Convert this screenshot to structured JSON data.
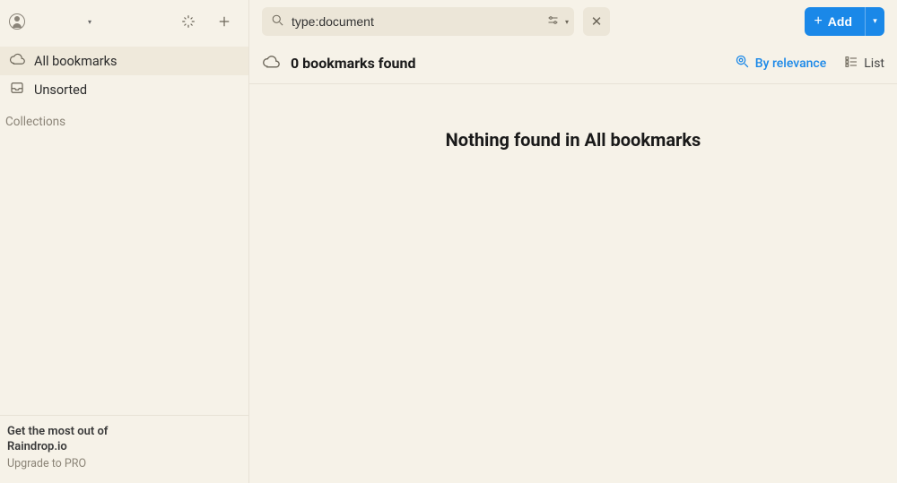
{
  "sidebar": {
    "items": [
      {
        "label": "All bookmarks",
        "icon": "cloud-icon"
      },
      {
        "label": "Unsorted",
        "icon": "inbox-icon"
      }
    ],
    "collections_label": "Collections"
  },
  "promo": {
    "line1": "Get the most out of",
    "line2": "Raindrop.io",
    "sub": "Upgrade to PRO"
  },
  "search": {
    "value": "type:document"
  },
  "add_button": {
    "label": "Add"
  },
  "subbar": {
    "count_text": "0 bookmarks found",
    "sort_label": "By relevance",
    "view_label": "List"
  },
  "empty": {
    "message": "Nothing found in All bookmarks"
  },
  "colors": {
    "accent": "#1a88e8"
  }
}
